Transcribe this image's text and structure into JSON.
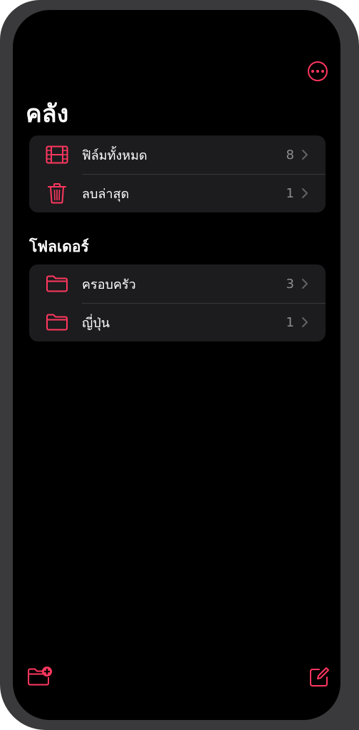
{
  "library": {
    "title": "คลัง",
    "items": [
      {
        "label": "ฟิล์มทั้งหมด",
        "count": "8",
        "icon": "film-icon"
      },
      {
        "label": "ลบล่าสุด",
        "count": "1",
        "icon": "trash-icon"
      }
    ]
  },
  "folders": {
    "header": "โฟลเดอร์",
    "items": [
      {
        "label": "ครอบครัว",
        "count": "3",
        "icon": "folder-icon"
      },
      {
        "label": "ญี่ปุ่น",
        "count": "1",
        "icon": "folder-icon"
      }
    ]
  },
  "toolbar": {
    "new_folder_icon": "new-folder-icon",
    "compose_icon": "compose-icon",
    "more_icon": "more-icon"
  },
  "colors": {
    "accent": "#ff375f",
    "background": "#000000",
    "group_background": "#1c1c1e",
    "secondary_text": "#8e8e93"
  }
}
